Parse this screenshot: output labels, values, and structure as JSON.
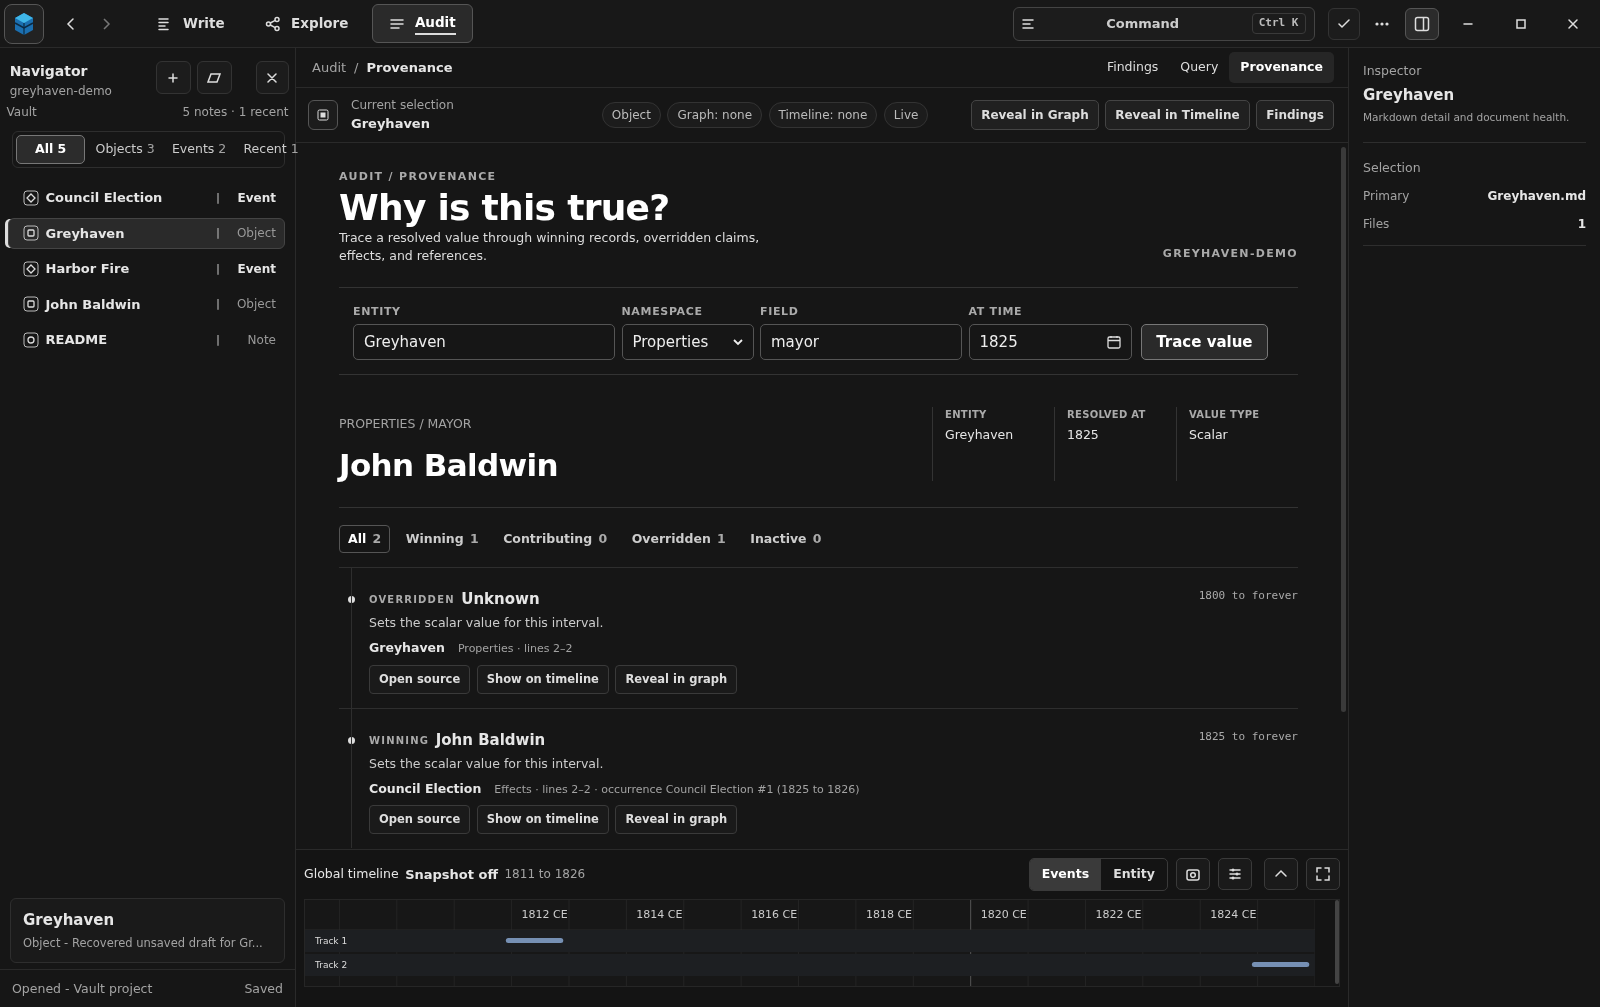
{
  "topbar": {
    "tabs": [
      {
        "label": "Write",
        "selected": false
      },
      {
        "label": "Explore",
        "selected": false
      },
      {
        "label": "Audit",
        "selected": true
      }
    ],
    "command": {
      "label": "Command",
      "shortcut": "Ctrl K"
    }
  },
  "navigator": {
    "title": "Navigator",
    "subtitle": "greyhaven-demo",
    "vault_label": "Vault",
    "vault_summary": "5 notes · 1 recent",
    "filters": [
      {
        "label": "All",
        "count": "5",
        "selected": true
      },
      {
        "label": "Objects",
        "count": "3",
        "selected": false
      },
      {
        "label": "Events",
        "count": "2",
        "selected": false
      },
      {
        "label": "Recent",
        "count": "1",
        "selected": false
      }
    ],
    "items": [
      {
        "name": "Council Election",
        "sep": "|",
        "type": "Event",
        "kind": "event",
        "selected": false
      },
      {
        "name": "Greyhaven",
        "sep": "|",
        "type": "Object",
        "kind": "object",
        "selected": true
      },
      {
        "name": "Harbor Fire",
        "sep": "|",
        "type": "Event",
        "kind": "event",
        "selected": false
      },
      {
        "name": "John Baldwin",
        "sep": "|",
        "type": "Object",
        "kind": "object",
        "selected": false
      },
      {
        "name": "README",
        "sep": "|",
        "type": "Note",
        "kind": "note",
        "selected": false
      }
    ],
    "card": {
      "title": "Greyhaven",
      "text": "Object - Recovered unsaved draft for Gr..."
    },
    "status": {
      "left": "Opened - Vault project",
      "right": "Saved"
    }
  },
  "main": {
    "breadcrumb": [
      "Audit",
      "/",
      "Provenance"
    ],
    "views": [
      {
        "label": "Findings",
        "selected": false
      },
      {
        "label": "Query",
        "selected": false
      },
      {
        "label": "Provenance",
        "selected": true
      }
    ],
    "selection": {
      "label": "Current selection",
      "value": "Greyhaven",
      "chips": [
        "Object",
        "Graph: none",
        "Timeline: none",
        "Live"
      ],
      "actions": [
        "Reveal in Graph",
        "Reveal in Timeline",
        "Findings"
      ]
    },
    "eyebrow": "AUDIT / PROVENANCE",
    "title": "Why is this true?",
    "lead": "Trace a resolved value through winning records, overridden claims, effects, and references.",
    "vault_tag": "GREYHAVEN-DEMO",
    "form": {
      "entity": {
        "label": "ENTITY",
        "value": "Greyhaven"
      },
      "namespace": {
        "label": "NAMESPACE",
        "value": "Properties"
      },
      "field": {
        "label": "FIELD",
        "value": "mayor"
      },
      "at_time": {
        "label": "AT TIME",
        "value": "1825"
      },
      "submit": "Trace value"
    },
    "result": {
      "path": "PROPERTIES / MAYOR",
      "value": "John Baldwin",
      "facts": [
        {
          "label": "ENTITY",
          "value": "Greyhaven"
        },
        {
          "label": "RESOLVED AT",
          "value": "1825"
        },
        {
          "label": "VALUE TYPE",
          "value": "Scalar"
        }
      ]
    },
    "evidence_tabs": [
      {
        "label": "All",
        "count": "2",
        "selected": true
      },
      {
        "label": "Winning",
        "count": "1",
        "selected": false
      },
      {
        "label": "Contributing",
        "count": "0",
        "selected": false
      },
      {
        "label": "Overridden",
        "count": "1",
        "selected": false
      },
      {
        "label": "Inactive",
        "count": "0",
        "selected": false
      }
    ],
    "claims": [
      {
        "status": "OVERRIDDEN",
        "value": "Unknown",
        "interval": "1800 to forever",
        "description": "Sets the scalar value for this interval.",
        "source": "Greyhaven",
        "source_meta": "Properties · lines 2–2",
        "actions": [
          "Open source",
          "Show on timeline",
          "Reveal in graph"
        ]
      },
      {
        "status": "WINNING",
        "value": "John Baldwin",
        "interval": "1825 to forever",
        "description": "Sets the scalar value for this interval.",
        "source": "Council Election",
        "source_meta": "Effects · lines 2–2 · occurrence Council Election #1 (1825 to 1826)",
        "actions": [
          "Open source",
          "Show on timeline",
          "Reveal in graph"
        ]
      }
    ]
  },
  "timeline": {
    "title": "Global timeline",
    "snapshot": "Snapshot off",
    "range": "1811 to 1826",
    "modes": [
      {
        "label": "Events",
        "selected": true
      },
      {
        "label": "Entity",
        "selected": false
      }
    ],
    "years": [
      "1812 CE",
      "1814 CE",
      "1816 CE",
      "1818 CE",
      "1820 CE",
      "1822 CE",
      "1824 CE"
    ],
    "tracks": [
      {
        "label": "Track 1"
      },
      {
        "label": "Track 2"
      }
    ]
  },
  "inspector": {
    "label": "Inspector",
    "title": "Greyhaven",
    "subtitle": "Markdown detail and document health.",
    "section": "Selection",
    "rows": [
      {
        "key": "Primary",
        "value": "Greyhaven.md"
      },
      {
        "key": "Files",
        "value": "1"
      }
    ]
  }
}
